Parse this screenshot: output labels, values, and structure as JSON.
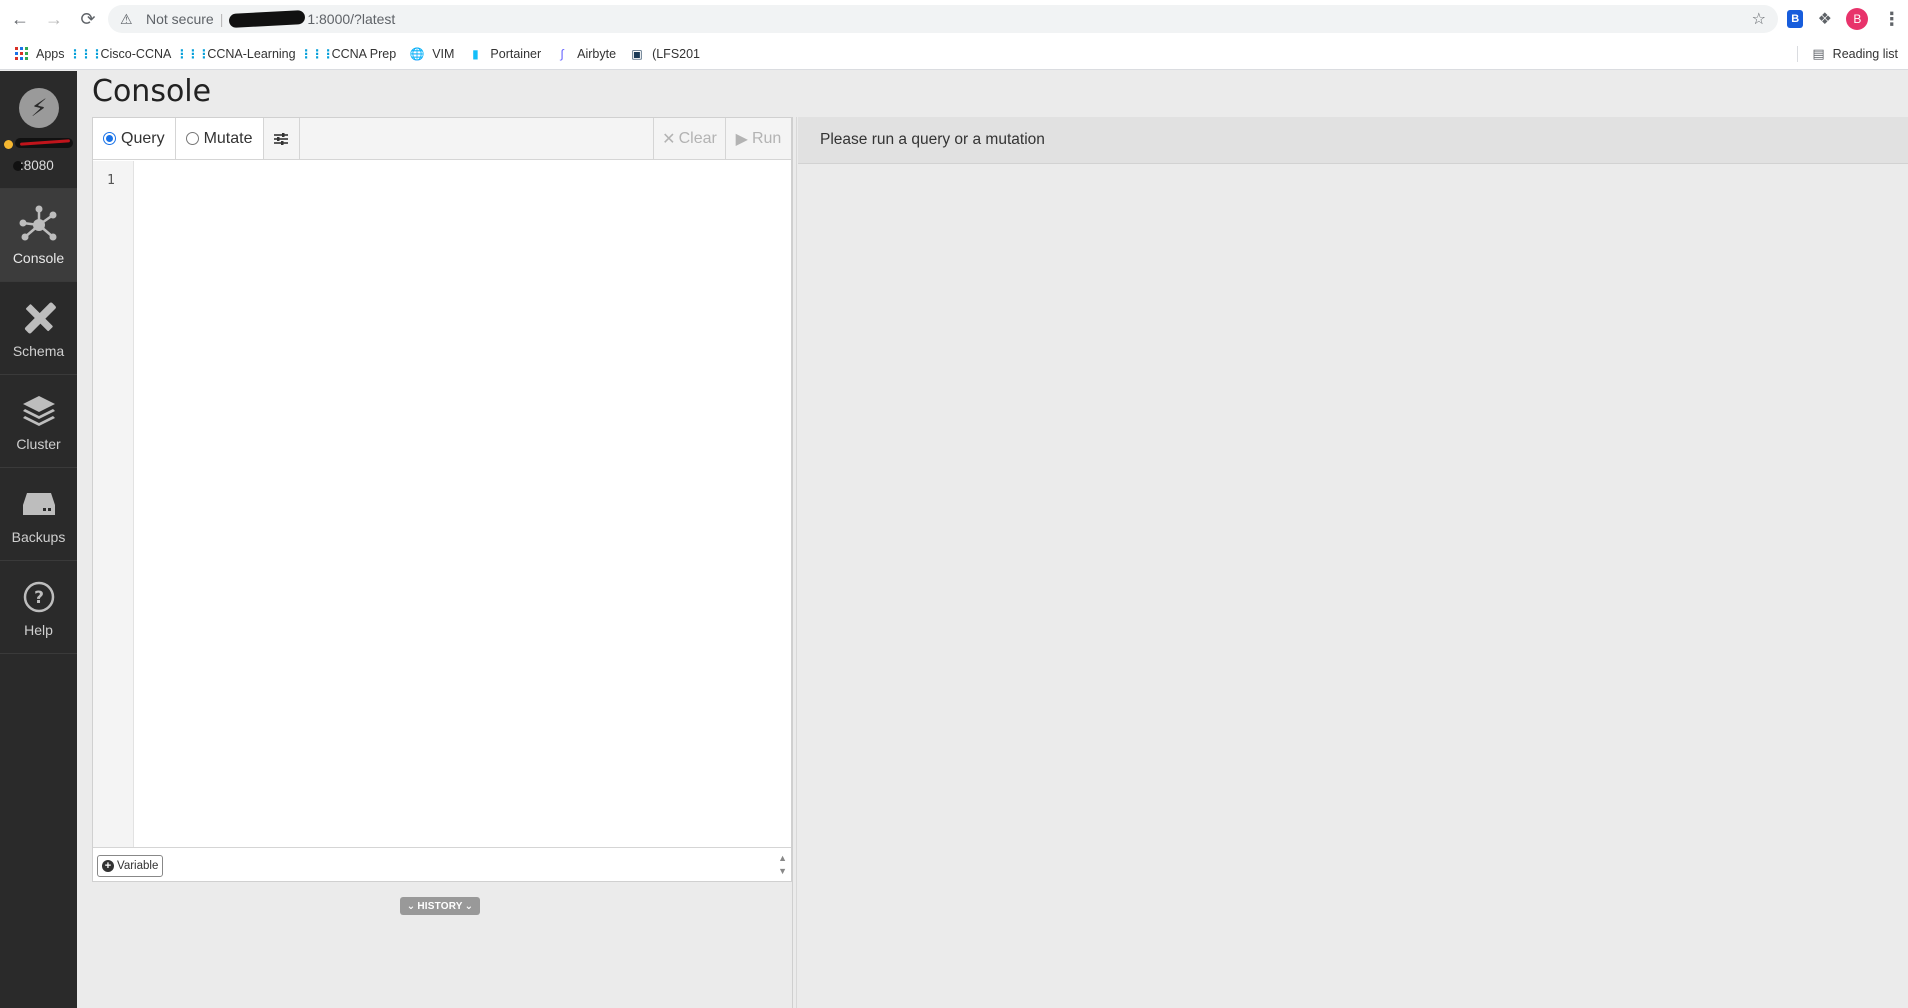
{
  "browser": {
    "security_label": "Not secure",
    "url": "1:8000/?latest",
    "avatar_letter": "B",
    "extension_badge": "B"
  },
  "bookmarks": [
    {
      "label": "Apps",
      "icon": "apps-grid-icon"
    },
    {
      "label": "Cisco-CCNA",
      "icon": "cisco-icon"
    },
    {
      "label": "CCNA-Learning",
      "icon": "cisco-icon"
    },
    {
      "label": "CCNA Prep",
      "icon": "cisco-icon"
    },
    {
      "label": "VIM",
      "icon": "globe-icon"
    },
    {
      "label": "Portainer",
      "icon": "portainer-icon"
    },
    {
      "label": "Airbyte",
      "icon": "airbyte-icon"
    },
    {
      "label": "(LFS201",
      "icon": "square-icon"
    }
  ],
  "reading_list": "Reading list",
  "sidebar": {
    "server_port": ":8080",
    "items": [
      {
        "label": "Console",
        "icon": "console-graph-icon",
        "active": true
      },
      {
        "label": "Schema",
        "icon": "schema-pencil-icon",
        "active": false
      },
      {
        "label": "Cluster",
        "icon": "cluster-layers-icon",
        "active": false
      },
      {
        "label": "Backups",
        "icon": "backups-drive-icon",
        "active": false
      },
      {
        "label": "Help",
        "icon": "help-question-icon",
        "active": false
      }
    ]
  },
  "page": {
    "title": "Console"
  },
  "editor": {
    "mode_options": [
      {
        "label": "Query",
        "selected": true
      },
      {
        "label": "Mutate",
        "selected": false
      }
    ],
    "clear_label": "Clear",
    "run_label": "Run",
    "line_number": "1",
    "variable_label": "Variable",
    "history_label": "HISTORY"
  },
  "results": {
    "placeholder": "Please run a query or a mutation"
  },
  "colors": {
    "sidebar_bg": "#2a2a2a",
    "accent_blue": "#1a73e8",
    "status_dot": "#f5b731",
    "avatar": "#e8336b"
  }
}
